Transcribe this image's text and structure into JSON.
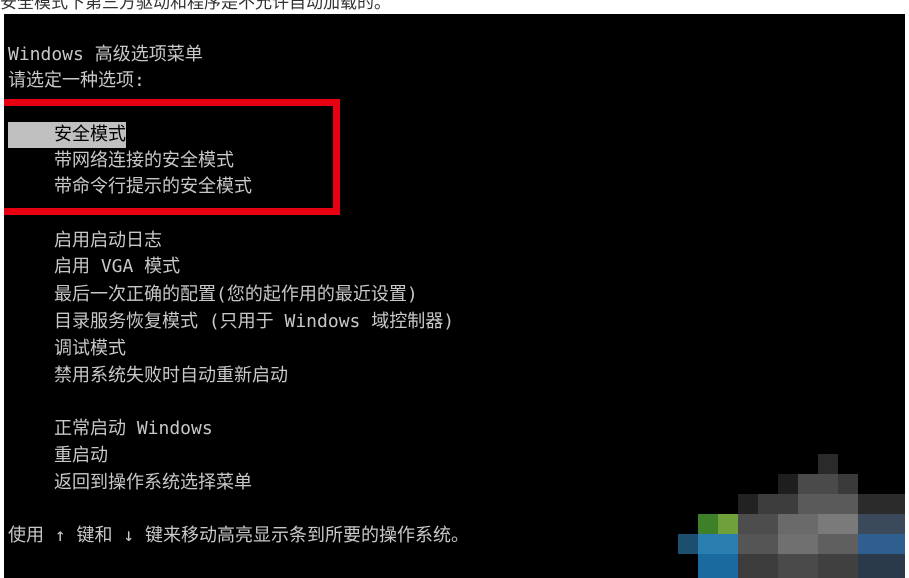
{
  "caption": "安全模式下第三方驱动和程序是不允许自动加载的。",
  "menu": {
    "title": "Windows 高级选项菜单",
    "prompt": "请选定一种选项:",
    "safe_modes": [
      "安全模式",
      "带网络连接的安全模式",
      "带命令行提示的安全模式"
    ],
    "advanced": [
      "启用启动日志",
      "启用 VGA 模式",
      "最后一次正确的配置(您的起作用的最近设置)",
      "目录服务恢复模式 (只用于 Windows 域控制器)",
      "调试模式",
      "禁用系统失败时自动重新启动"
    ],
    "boot": [
      "正常启动 Windows",
      "重启动",
      "返回到操作系统选择菜单"
    ],
    "footer": "使用 ↑ 键和 ↓ 键来移动高亮显示条到所要的操作系统。"
  },
  "colors": {
    "console_bg": "#000000",
    "console_text": "#c8c8c8",
    "highlight_bg": "#c0c0c0",
    "annotation_red": "#e60012"
  }
}
